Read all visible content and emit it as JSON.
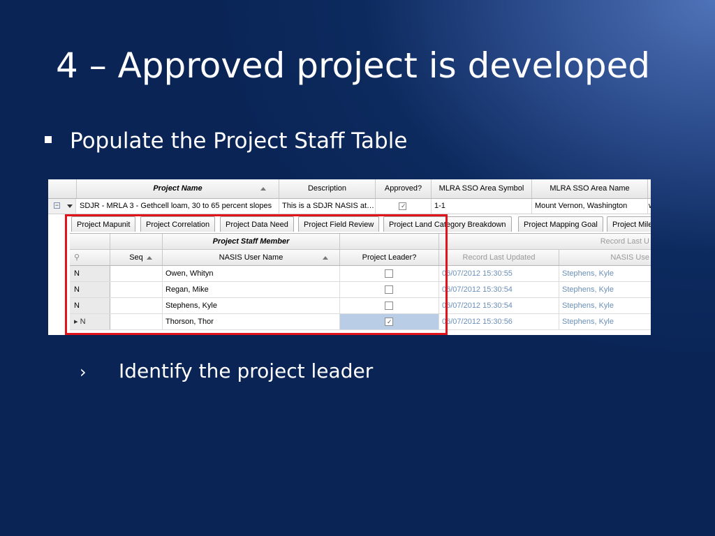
{
  "slide": {
    "title": "4 – Approved project is developed",
    "bullet": "Populate the Project Staff Table",
    "sub_bullet_mark": "›",
    "sub_bullet": "Identify the project leader"
  },
  "project_grid": {
    "headers": [
      "Project Name",
      "Description",
      "Approved?",
      "MLRA SSO Area Symbol",
      "MLRA SSO Area Name"
    ],
    "row": {
      "expander": "−",
      "name": "SDJR - MRLA 3 - Gethcell loam, 30 to 65 percent slopes",
      "description": "This is a SDJR NASIS at…",
      "approved": true,
      "area_symbol": "1-1",
      "area_name": "Mount Vernon, Washington",
      "overflow_text": "w"
    }
  },
  "tabs": [
    "Project Mapunit",
    "Project Correlation",
    "Project Data Need",
    "Project Field Review",
    "Project Land Category Breakdown",
    "Project Mapping Goal",
    "Project Mile"
  ],
  "staff_table": {
    "group_header": "Project Staff Member",
    "group_header_right": "Record Last U",
    "search_icon_glyph": "⚲",
    "columns": [
      "Seq",
      "NASIS User Name",
      "Project Leader?",
      "Record Last Updated",
      "NASIS Use"
    ],
    "rows": [
      {
        "marker": "N",
        "seq": "",
        "user": "Owen, Whityn",
        "leader": false,
        "updated": "06/07/2012 15:30:55",
        "updated_by": "Stephens, Kyle"
      },
      {
        "marker": "N",
        "seq": "",
        "user": "Regan, Mike",
        "leader": false,
        "updated": "06/07/2012 15:30:54",
        "updated_by": "Stephens, Kyle"
      },
      {
        "marker": "N",
        "seq": "",
        "user": "Stephens, Kyle",
        "leader": false,
        "updated": "06/07/2012 15:30:54",
        "updated_by": "Stephens, Kyle"
      },
      {
        "marker": "▸ N",
        "seq": "",
        "user": "Thorson, Thor",
        "leader": true,
        "updated": "06/07/2012 15:30:56",
        "updated_by": "Stephens, Kyle"
      }
    ]
  },
  "colors": {
    "highlight_border": "#e0141a",
    "selected_cell": "#b9cde6"
  }
}
